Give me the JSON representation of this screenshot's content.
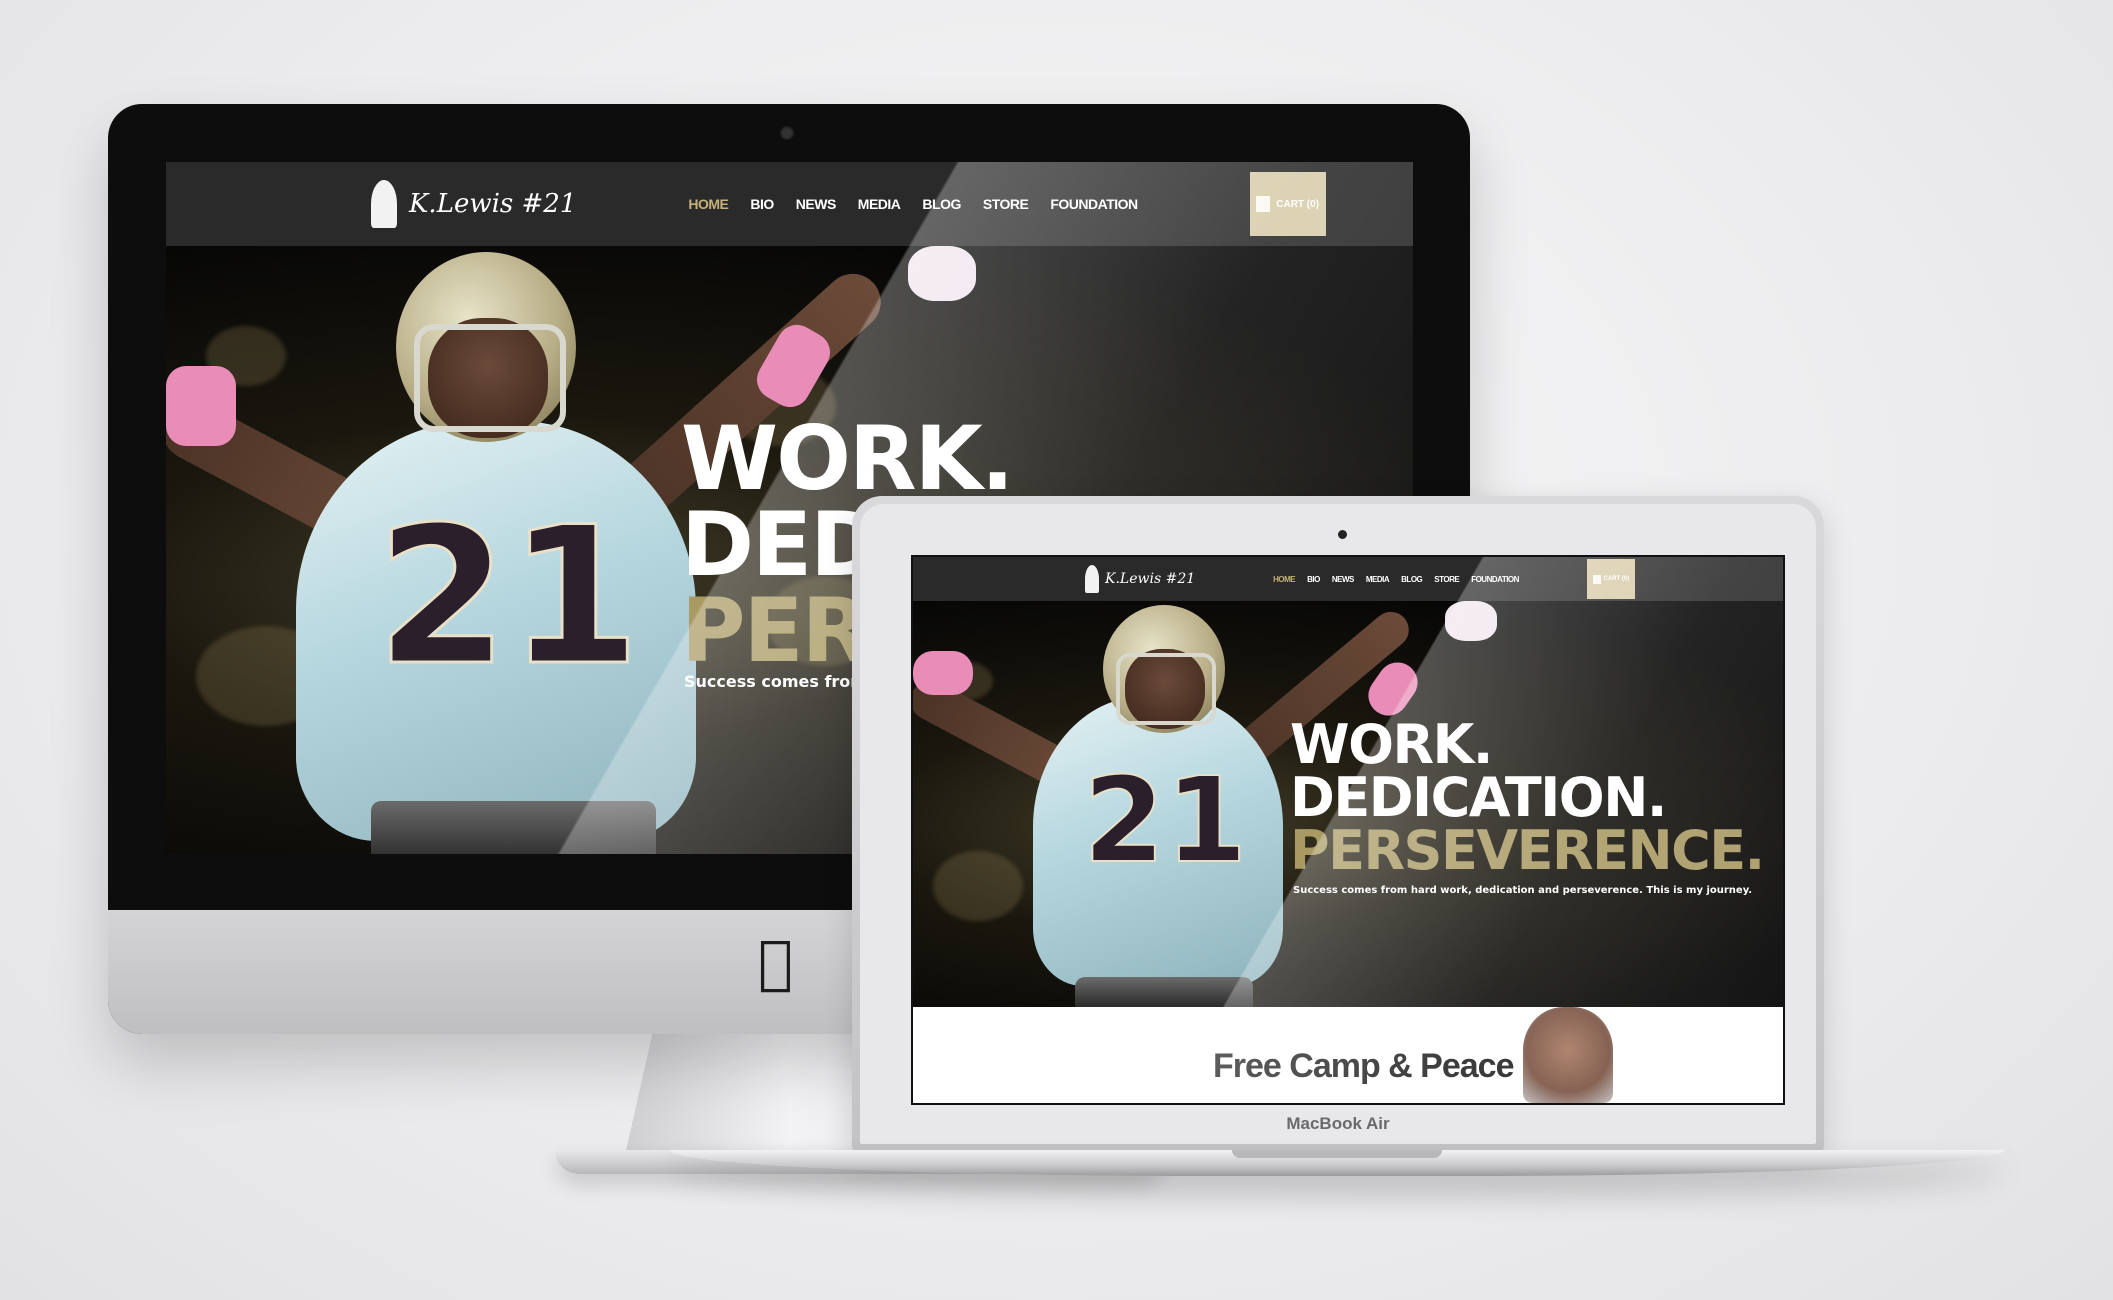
{
  "site": {
    "logo_signature": "K.Lewis #21",
    "menu": [
      "HOME",
      "BIO",
      "NEWS",
      "MEDIA",
      "BLOG",
      "STORE",
      "FOUNDATION"
    ],
    "active_menu": "HOME",
    "cart_label": "CART (0)",
    "hero": {
      "line1": "WORK.",
      "line2": "DEDICATION.",
      "line3": "PERSEVERENCE.",
      "imac_line2": "DED",
      "imac_line3": "PER",
      "tagline": "Success comes from hard work, dedication and perseverence. This is my journey.",
      "imac_tagline": "Success comes from h",
      "jersey_number": "21"
    },
    "promo_title": "Free Camp & Peace Rally"
  },
  "device": {
    "macbook_label": "MacBook Air",
    "apple_logo": "apple-logo-icon"
  },
  "colors": {
    "gold": "#a99a63",
    "nav_bg": "#2a2a2a",
    "cart_bg": "#d8ccaa",
    "active_menu": "#c4b07a"
  }
}
